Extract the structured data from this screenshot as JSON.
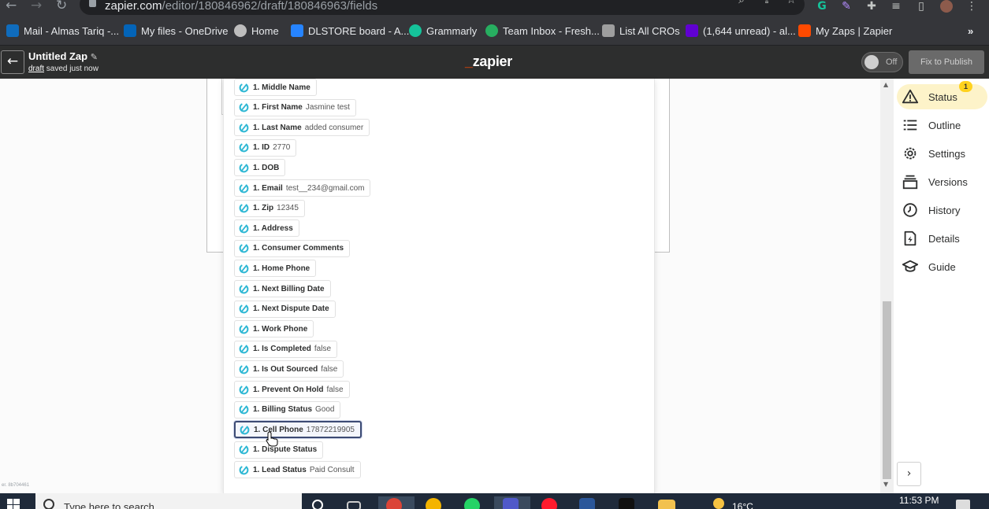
{
  "browser": {
    "url_host": "zapier.com",
    "url_path": "/editor/180846962/draft/180846963/fields",
    "bookmarks": [
      {
        "label": "Mail - Almas Tariq -...",
        "color": "#0f6cbd"
      },
      {
        "label": "My files - OneDrive",
        "color": "#0364b8"
      },
      {
        "label": "Home",
        "color": "#bdbdbd"
      },
      {
        "label": "DLSTORE board - A...",
        "color": "#2684ff"
      },
      {
        "label": "Grammarly",
        "color": "#15c39a"
      },
      {
        "label": "Team Inbox - Fresh...",
        "color": "#27ae60"
      },
      {
        "label": "List All CROs",
        "color": "#9e9e9e"
      },
      {
        "label": "(1,644 unread) - al...",
        "color": "#6001d2"
      },
      {
        "label": "My Zaps | Zapier",
        "color": "#ff4a00"
      }
    ]
  },
  "header": {
    "title": "Untitled Zap",
    "draft_link": "draft",
    "saved_text": " saved just now",
    "logo_underscore": "_",
    "logo_text": "zapier",
    "toggle_label": "Off",
    "publish_label": "Fix to Publish"
  },
  "fields": [
    {
      "label": "1. Middle Name",
      "value": ""
    },
    {
      "label": "1. First Name",
      "value": "Jasmine test"
    },
    {
      "label": "1. Last Name",
      "value": "added consumer"
    },
    {
      "label": "1. ID",
      "value": "2770"
    },
    {
      "label": "1. DOB",
      "value": ""
    },
    {
      "label": "1. Email",
      "value": "test__234@gmail.com"
    },
    {
      "label": "1. Zip",
      "value": "12345"
    },
    {
      "label": "1. Address",
      "value": ""
    },
    {
      "label": "1. Consumer Comments",
      "value": ""
    },
    {
      "label": "1. Home Phone",
      "value": ""
    },
    {
      "label": "1. Next Billing Date",
      "value": ""
    },
    {
      "label": "1. Next Dispute Date",
      "value": ""
    },
    {
      "label": "1. Work Phone",
      "value": ""
    },
    {
      "label": "1. Is Completed",
      "value": "false"
    },
    {
      "label": "1. Is Out Sourced",
      "value": "false"
    },
    {
      "label": "1. Prevent On Hold",
      "value": "false"
    },
    {
      "label": "1. Billing Status",
      "value": "Good"
    },
    {
      "label": "1. Cell Phone",
      "value": "17872219905",
      "selected": true
    },
    {
      "label": "1. Dispute Status",
      "value": ""
    },
    {
      "label": "1. Lead Status",
      "value": "Paid Consult"
    }
  ],
  "sidebar": {
    "badge": "1",
    "items": [
      {
        "label": "Status",
        "icon": "warning-icon",
        "active": true
      },
      {
        "label": "Outline",
        "icon": "list-icon"
      },
      {
        "label": "Settings",
        "icon": "gear-icon"
      },
      {
        "label": "Versions",
        "icon": "stack-icon"
      },
      {
        "label": "History",
        "icon": "clock-icon"
      },
      {
        "label": "Details",
        "icon": "file-bolt-icon"
      },
      {
        "label": "Guide",
        "icon": "graduation-cap-icon"
      }
    ],
    "expand_icon": "chevron-right-icon"
  },
  "version_string": "er. 8b704461",
  "taskbar": {
    "search_placeholder": "Type here to search",
    "temperature": "16°C",
    "time": "11:53 PM"
  }
}
